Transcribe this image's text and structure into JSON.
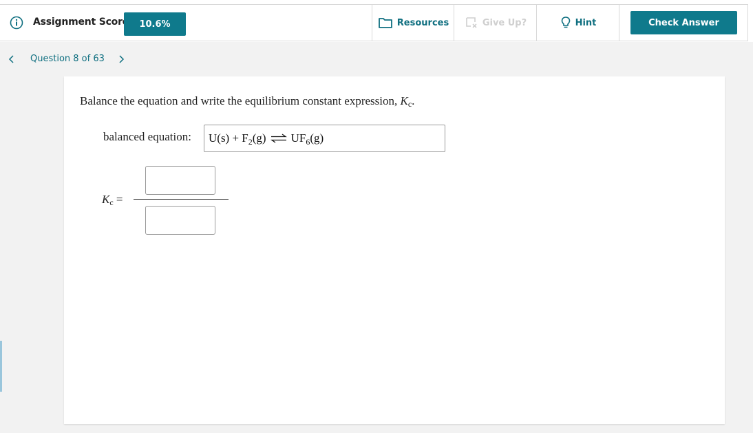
{
  "toolbar": {
    "score_label": "Assignment Score:",
    "score_value": "10.6%",
    "resources_label": "Resources",
    "giveup_label": "Give Up?",
    "hint_label": "Hint",
    "check_label": "Check Answer"
  },
  "nav": {
    "question_label": "Question 8 of 63"
  },
  "question": {
    "prompt_text": "Balance the equation and write the equilibrium constant expression,",
    "prompt_symbol": "K",
    "prompt_symbol_sub": "c",
    "prompt_end": ".",
    "eq_label": "balanced equation:",
    "eq_reactants": "U(s) + F",
    "eq_sub1": "2",
    "eq_mid": "(g)",
    "eq_product": "UF",
    "eq_sub2": "6",
    "eq_end": "(g)",
    "kc_symbol": "K",
    "kc_sub": "c",
    "kc_equals": "=",
    "numerator_value": "",
    "denominator_value": ""
  },
  "colors": {
    "accent": "#0f7a8c",
    "link": "#0f6f80",
    "disabled": "#cfcfcf",
    "background": "#f2f2f2"
  }
}
